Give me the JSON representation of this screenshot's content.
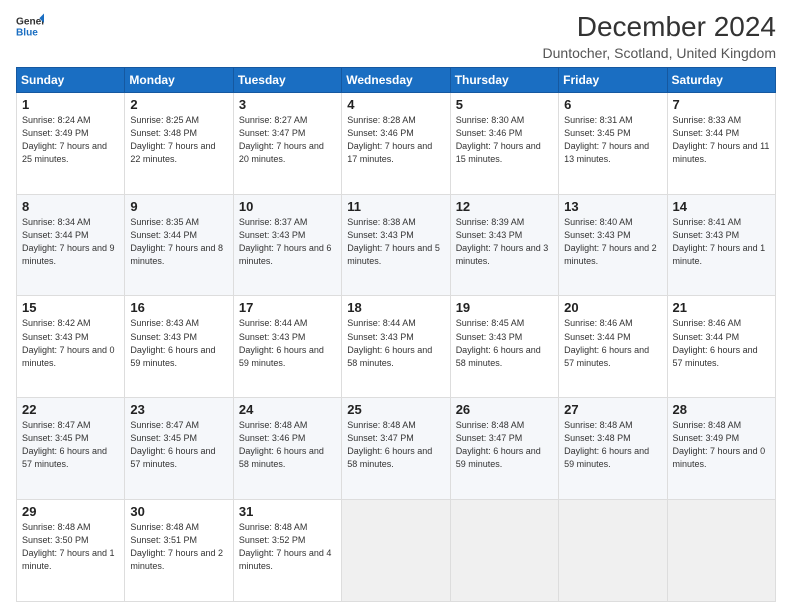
{
  "logo": {
    "line1": "General",
    "line2": "Blue",
    "icon_color": "#1a6ec2"
  },
  "header": {
    "title": "December 2024",
    "subtitle": "Duntocher, Scotland, United Kingdom"
  },
  "weekdays": [
    "Sunday",
    "Monday",
    "Tuesday",
    "Wednesday",
    "Thursday",
    "Friday",
    "Saturday"
  ],
  "weeks": [
    [
      {
        "day": "1",
        "sunrise": "8:24 AM",
        "sunset": "3:49 PM",
        "daylight": "7 hours and 25 minutes."
      },
      {
        "day": "2",
        "sunrise": "8:25 AM",
        "sunset": "3:48 PM",
        "daylight": "7 hours and 22 minutes."
      },
      {
        "day": "3",
        "sunrise": "8:27 AM",
        "sunset": "3:47 PM",
        "daylight": "7 hours and 20 minutes."
      },
      {
        "day": "4",
        "sunrise": "8:28 AM",
        "sunset": "3:46 PM",
        "daylight": "7 hours and 17 minutes."
      },
      {
        "day": "5",
        "sunrise": "8:30 AM",
        "sunset": "3:46 PM",
        "daylight": "7 hours and 15 minutes."
      },
      {
        "day": "6",
        "sunrise": "8:31 AM",
        "sunset": "3:45 PM",
        "daylight": "7 hours and 13 minutes."
      },
      {
        "day": "7",
        "sunrise": "8:33 AM",
        "sunset": "3:44 PM",
        "daylight": "7 hours and 11 minutes."
      }
    ],
    [
      {
        "day": "8",
        "sunrise": "8:34 AM",
        "sunset": "3:44 PM",
        "daylight": "7 hours and 9 minutes."
      },
      {
        "day": "9",
        "sunrise": "8:35 AM",
        "sunset": "3:44 PM",
        "daylight": "7 hours and 8 minutes."
      },
      {
        "day": "10",
        "sunrise": "8:37 AM",
        "sunset": "3:43 PM",
        "daylight": "7 hours and 6 minutes."
      },
      {
        "day": "11",
        "sunrise": "8:38 AM",
        "sunset": "3:43 PM",
        "daylight": "7 hours and 5 minutes."
      },
      {
        "day": "12",
        "sunrise": "8:39 AM",
        "sunset": "3:43 PM",
        "daylight": "7 hours and 3 minutes."
      },
      {
        "day": "13",
        "sunrise": "8:40 AM",
        "sunset": "3:43 PM",
        "daylight": "7 hours and 2 minutes."
      },
      {
        "day": "14",
        "sunrise": "8:41 AM",
        "sunset": "3:43 PM",
        "daylight": "7 hours and 1 minute."
      }
    ],
    [
      {
        "day": "15",
        "sunrise": "8:42 AM",
        "sunset": "3:43 PM",
        "daylight": "7 hours and 0 minutes."
      },
      {
        "day": "16",
        "sunrise": "8:43 AM",
        "sunset": "3:43 PM",
        "daylight": "6 hours and 59 minutes."
      },
      {
        "day": "17",
        "sunrise": "8:44 AM",
        "sunset": "3:43 PM",
        "daylight": "6 hours and 59 minutes."
      },
      {
        "day": "18",
        "sunrise": "8:44 AM",
        "sunset": "3:43 PM",
        "daylight": "6 hours and 58 minutes."
      },
      {
        "day": "19",
        "sunrise": "8:45 AM",
        "sunset": "3:43 PM",
        "daylight": "6 hours and 58 minutes."
      },
      {
        "day": "20",
        "sunrise": "8:46 AM",
        "sunset": "3:44 PM",
        "daylight": "6 hours and 57 minutes."
      },
      {
        "day": "21",
        "sunrise": "8:46 AM",
        "sunset": "3:44 PM",
        "daylight": "6 hours and 57 minutes."
      }
    ],
    [
      {
        "day": "22",
        "sunrise": "8:47 AM",
        "sunset": "3:45 PM",
        "daylight": "6 hours and 57 minutes."
      },
      {
        "day": "23",
        "sunrise": "8:47 AM",
        "sunset": "3:45 PM",
        "daylight": "6 hours and 57 minutes."
      },
      {
        "day": "24",
        "sunrise": "8:48 AM",
        "sunset": "3:46 PM",
        "daylight": "6 hours and 58 minutes."
      },
      {
        "day": "25",
        "sunrise": "8:48 AM",
        "sunset": "3:47 PM",
        "daylight": "6 hours and 58 minutes."
      },
      {
        "day": "26",
        "sunrise": "8:48 AM",
        "sunset": "3:47 PM",
        "daylight": "6 hours and 59 minutes."
      },
      {
        "day": "27",
        "sunrise": "8:48 AM",
        "sunset": "3:48 PM",
        "daylight": "6 hours and 59 minutes."
      },
      {
        "day": "28",
        "sunrise": "8:48 AM",
        "sunset": "3:49 PM",
        "daylight": "7 hours and 0 minutes."
      }
    ],
    [
      {
        "day": "29",
        "sunrise": "8:48 AM",
        "sunset": "3:50 PM",
        "daylight": "7 hours and 1 minute."
      },
      {
        "day": "30",
        "sunrise": "8:48 AM",
        "sunset": "3:51 PM",
        "daylight": "7 hours and 2 minutes."
      },
      {
        "day": "31",
        "sunrise": "8:48 AM",
        "sunset": "3:52 PM",
        "daylight": "7 hours and 4 minutes."
      },
      null,
      null,
      null,
      null
    ]
  ]
}
